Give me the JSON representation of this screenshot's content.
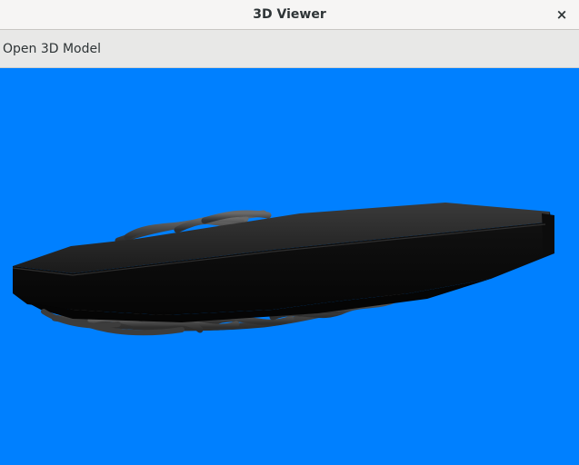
{
  "window": {
    "title": "3D Viewer",
    "close_symbol": "×"
  },
  "menubar": {
    "open_model_label": "Open 3D Model"
  },
  "viewport": {
    "background_color": "#0080ff",
    "model_color": "#141414"
  },
  "icons": {
    "close": "close-icon"
  }
}
